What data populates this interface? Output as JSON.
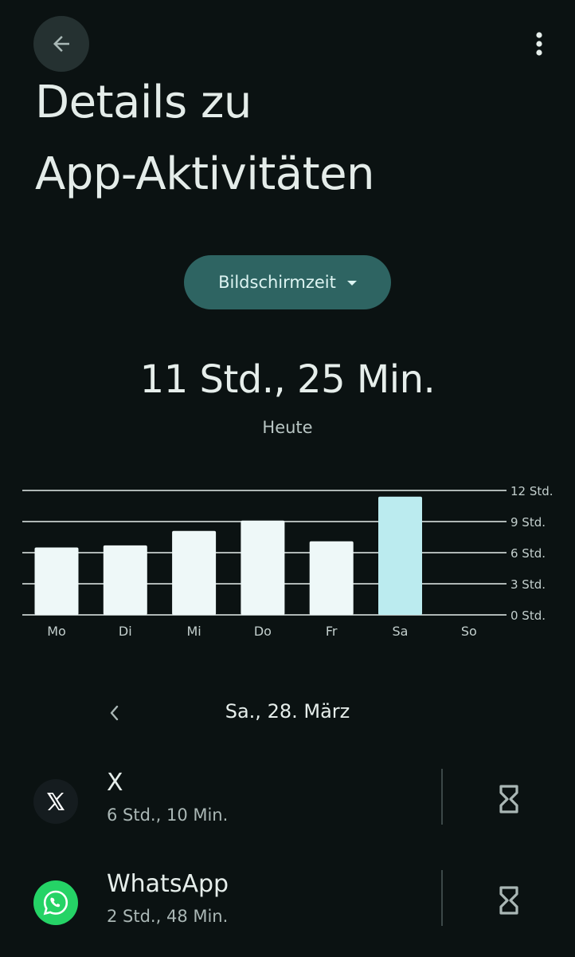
{
  "header": {
    "title_line1": "Details zu",
    "title_line2": "App-Aktivitäten"
  },
  "metric_selector": {
    "label": "Bildschirmzeit"
  },
  "summary": {
    "total": "11 Std., 25 Min.",
    "period": "Heute"
  },
  "chart_data": {
    "type": "bar",
    "categories": [
      "Mo",
      "Di",
      "Mi",
      "Do",
      "Fr",
      "Sa",
      "So"
    ],
    "values": [
      6.5,
      6.7,
      8.1,
      9.1,
      7.1,
      11.4,
      0
    ],
    "highlighted_category": "Sa",
    "ytick_labels": [
      "0 Std.",
      "3 Std.",
      "6 Std.",
      "9 Std.",
      "12 Std."
    ],
    "yticks": [
      0,
      3,
      6,
      9,
      12
    ],
    "ylim": [
      0,
      12
    ],
    "unit": "Std.",
    "grid": true,
    "colors": {
      "bar": "#eef8f8",
      "highlight": "#bbebef",
      "grid": "#e6eeeb",
      "tick_label": "#c3cfcd"
    }
  },
  "date_nav": {
    "date": "Sa., 28. März"
  },
  "apps": [
    {
      "name": "X",
      "time": "6 Std., 10 Min.",
      "icon": "x-logo-icon"
    },
    {
      "name": "WhatsApp",
      "time": "2 Std., 48 Min.",
      "icon": "whatsapp-logo-icon"
    }
  ],
  "colors": {
    "background": "#0b1212",
    "accent_chip": "#2e6462",
    "whatsapp_green": "#25d366"
  }
}
